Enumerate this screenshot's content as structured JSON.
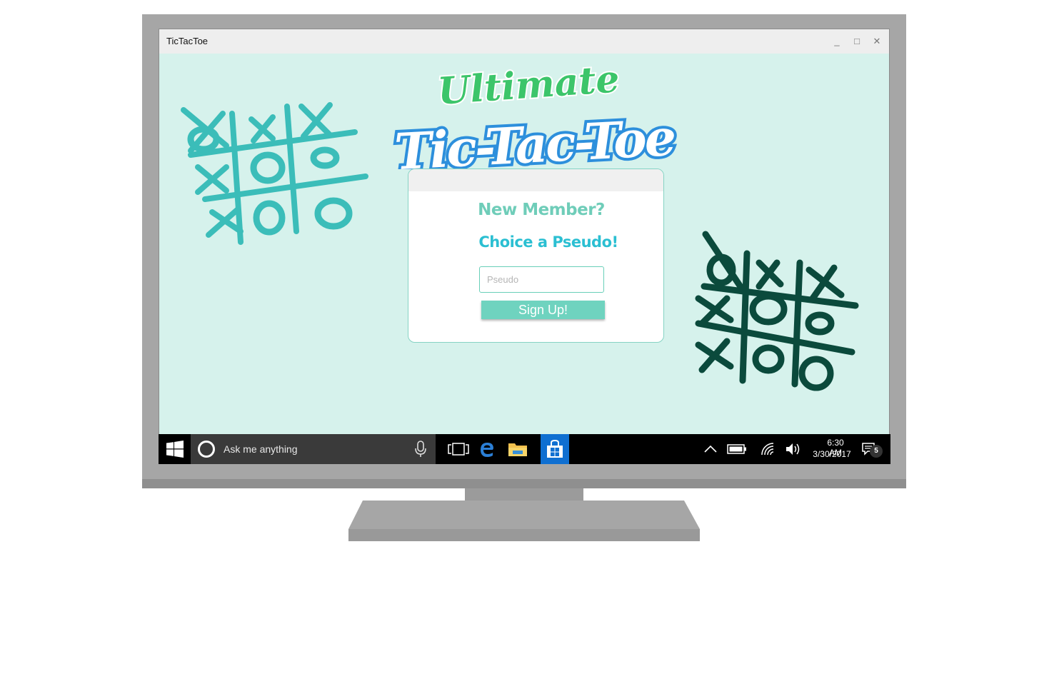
{
  "window": {
    "title": "TicTacToe"
  },
  "logo": {
    "line1": "Ultimate",
    "line2": "Tic-Tac-Toe"
  },
  "signup": {
    "heading": "New Member?",
    "subheading": "Choice a Pseudo!",
    "input_placeholder": "Pseudo",
    "button_label": "Sign Up!"
  },
  "taskbar": {
    "search_placeholder": "Ask me anything",
    "time": "6:30 AM",
    "date": "3/30/2017",
    "notification_count": "5"
  },
  "colors": {
    "window_bg": "#d6f2ec",
    "accent": "#6fd3bf",
    "logo_green": "#3cc56a",
    "logo_blue": "#2d8fdc",
    "deco_left": "#3bbdb9",
    "deco_right": "#0b4a3c"
  }
}
